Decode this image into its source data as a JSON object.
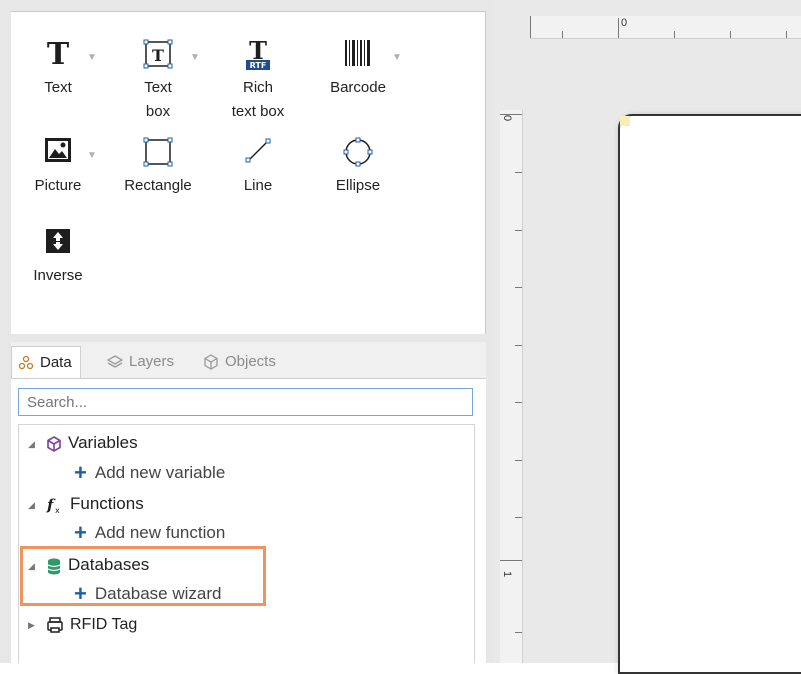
{
  "toolbox": {
    "row1": [
      {
        "label": "Text",
        "icon": "text-icon",
        "has_dropdown": true
      },
      {
        "label": "Text\nbox",
        "icon": "text-box-icon",
        "has_dropdown": true
      },
      {
        "label": "Rich\ntext box",
        "icon": "rich-text-box-icon",
        "badge": "RTF",
        "has_dropdown": false
      },
      {
        "label": "Barcode",
        "icon": "barcode-icon",
        "has_dropdown": true
      }
    ],
    "row2": [
      {
        "label": "Picture",
        "icon": "picture-icon",
        "has_dropdown": true
      },
      {
        "label": "Rectangle",
        "icon": "rectangle-icon",
        "has_dropdown": false
      },
      {
        "label": "Line",
        "icon": "line-icon",
        "has_dropdown": false
      },
      {
        "label": "Ellipse",
        "icon": "ellipse-icon",
        "has_dropdown": false
      }
    ],
    "row3": [
      {
        "label": "Inverse",
        "icon": "inverse-icon",
        "has_dropdown": false
      }
    ],
    "dropdown_glyph": "▼"
  },
  "data_panel": {
    "tabs": [
      {
        "label": "Data",
        "icon": "data-icon",
        "active": true
      },
      {
        "label": "Layers",
        "icon": "layers-icon",
        "active": false
      },
      {
        "label": "Objects",
        "icon": "objects-icon",
        "active": false
      }
    ],
    "search": {
      "placeholder": "Search...",
      "value": ""
    },
    "tree": [
      {
        "label": "Variables",
        "icon": "variables-icon",
        "expanded": true,
        "child": "Add new variable"
      },
      {
        "label": "Functions",
        "icon": "functions-icon",
        "expanded": true,
        "child": "Add new function"
      },
      {
        "label": "Databases",
        "icon": "databases-icon",
        "expanded": true,
        "child": "Database wizard",
        "highlighted": true
      },
      {
        "label": "RFID Tag",
        "icon": "rfid-tag-icon",
        "expanded": false
      }
    ],
    "add_glyph": "+",
    "expanded_glyph": "◢",
    "collapsed_glyph": "▶"
  },
  "canvas": {
    "ruler_top_zero": "0",
    "ruler_left_zero": "0",
    "ruler_left_one": "1"
  },
  "colors": {
    "highlight": "#f0935e",
    "accent_blue": "#1f5ea8",
    "variables_purple": "#7b3fa0",
    "databases_green": "#2e9a6a",
    "label_corner": "#f6edb8"
  }
}
